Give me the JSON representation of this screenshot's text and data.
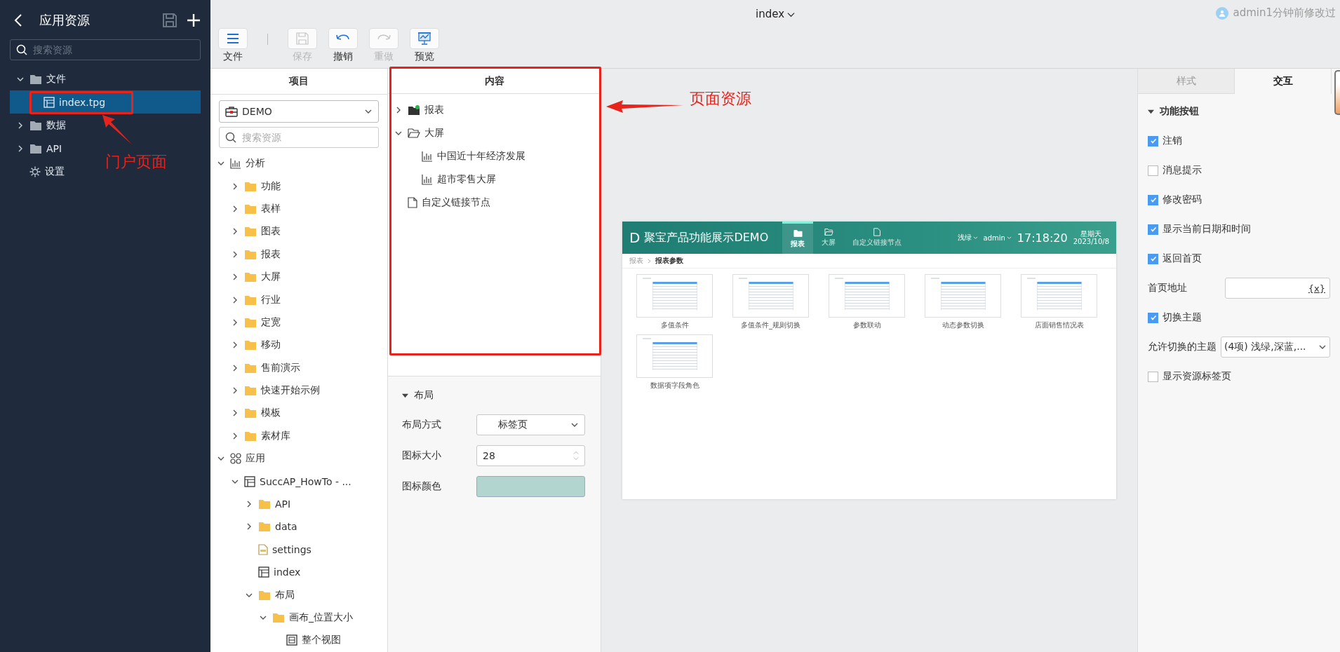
{
  "sidebar": {
    "title": "应用资源",
    "search": {
      "placeholder": "搜索资源"
    },
    "items": [
      {
        "label": "文件",
        "kind": "folder",
        "expanded": true,
        "selected": false,
        "children": [
          {
            "label": "index.tpg",
            "kind": "page",
            "selected": true
          }
        ]
      },
      {
        "label": "数据",
        "kind": "folder",
        "expanded": false,
        "selected": false
      },
      {
        "label": "API",
        "kind": "folder",
        "expanded": false,
        "selected": false
      },
      {
        "label": "设置",
        "kind": "settings",
        "selected": false
      }
    ]
  },
  "header": {
    "title": "index",
    "status": "admin1分钟前修改过"
  },
  "toolbar": [
    {
      "label": "文件",
      "kind": "menu",
      "disabled": false
    },
    {
      "label": "保存",
      "kind": "save",
      "disabled": true
    },
    {
      "label": "撤销",
      "kind": "undo",
      "disabled": false
    },
    {
      "label": "重做",
      "kind": "redo",
      "disabled": true
    },
    {
      "label": "预览",
      "kind": "preview",
      "disabled": false
    }
  ],
  "project": {
    "title": "项目",
    "name": "DEMO",
    "search": {
      "placeholder": "搜索资源"
    },
    "tree": [
      {
        "label": "分析",
        "kind": "chart",
        "expanded": true,
        "selected": false,
        "children": [
          {
            "label": "功能",
            "kind": "folder",
            "expanded": false,
            "selected": false
          },
          {
            "label": "表样",
            "kind": "folder",
            "expanded": false,
            "selected": false
          },
          {
            "label": "图表",
            "kind": "folder",
            "expanded": false,
            "selected": false
          },
          {
            "label": "报表",
            "kind": "folder",
            "expanded": false,
            "selected": false
          },
          {
            "label": "大屏",
            "kind": "folder",
            "expanded": false,
            "selected": false
          },
          {
            "label": "行业",
            "kind": "folder",
            "expanded": false,
            "selected": false
          },
          {
            "label": "定宽",
            "kind": "folder",
            "expanded": false,
            "selected": false
          },
          {
            "label": "移动",
            "kind": "folder",
            "expanded": false,
            "selected": false
          },
          {
            "label": "售前演示",
            "kind": "folder",
            "expanded": false,
            "selected": false
          },
          {
            "label": "快速开始示例",
            "kind": "folder",
            "expanded": false,
            "selected": false
          },
          {
            "label": "模板",
            "kind": "folder",
            "expanded": false,
            "selected": false
          },
          {
            "label": "素材库",
            "kind": "folder",
            "expanded": false,
            "selected": false
          }
        ]
      },
      {
        "label": "应用",
        "kind": "app",
        "expanded": true,
        "selected": false,
        "children": [
          {
            "label": "SuccAP_HowTo - ...",
            "kind": "page",
            "expanded": true,
            "selected": false,
            "children": [
              {
                "label": "API",
                "kind": "folder",
                "expanded": false,
                "selected": false
              },
              {
                "label": "data",
                "kind": "folder",
                "expanded": false,
                "selected": false
              },
              {
                "label": "settings",
                "kind": "json",
                "selected": false
              },
              {
                "label": "index",
                "kind": "page",
                "selected": false
              },
              {
                "label": "布局",
                "kind": "folder",
                "expanded": true,
                "selected": false,
                "children": [
                  {
                    "label": "画布_位置大小",
                    "kind": "folder",
                    "expanded": true,
                    "selected": false,
                    "children": [
                      {
                        "label": "整个视图",
                        "kind": "view",
                        "selected": false
                      }
                    ]
                  }
                ]
              }
            ]
          }
        ]
      }
    ]
  },
  "content": {
    "title": "内容",
    "tree": [
      {
        "label": "报表",
        "kind": "folder-dot",
        "expanded": false,
        "selected": false
      },
      {
        "label": "大屏",
        "kind": "folder-open",
        "expanded": true,
        "selected": false,
        "children": [
          {
            "label": "中国近十年经济发展",
            "kind": "chart",
            "selected": false
          },
          {
            "label": "超市零售大屏",
            "kind": "chart",
            "selected": false
          }
        ]
      },
      {
        "label": "自定义链接节点",
        "kind": "file",
        "selected": false
      }
    ],
    "layout": {
      "title": "布局",
      "expanded": true,
      "fields": [
        {
          "label": "布局方式",
          "kind": "select",
          "value": "标签页"
        },
        {
          "label": "图标大小",
          "kind": "number",
          "value": "28"
        },
        {
          "label": "图标颜色",
          "kind": "color",
          "color": "#b3d5cf"
        }
      ]
    }
  },
  "preview": {
    "logo": "D",
    "title": "聚宝产品功能展示DEMO",
    "nav": [
      {
        "label": "报表",
        "kind": "folder",
        "selected": true
      },
      {
        "label": "大屏",
        "kind": "folder-open",
        "selected": false
      },
      {
        "label": "自定义链接节点",
        "kind": "file",
        "selected": false
      }
    ],
    "theme": "浅绿",
    "user": "admin",
    "time": "17:18:20",
    "weekday": "星期天",
    "date": "2023/10/8",
    "breadcrumb": [
      "报表",
      "报表参数"
    ],
    "reports": [
      "多值条件",
      "多值条件_规则切换",
      "参数联动",
      "动态参数切换",
      "店面销售情况表",
      "数据项字段角色"
    ]
  },
  "properties": {
    "tabs": [
      {
        "label": "样式",
        "selected": false
      },
      {
        "label": "交互",
        "selected": true
      }
    ],
    "section": {
      "title": "功能按钮",
      "expanded": true
    },
    "rows": [
      {
        "kind": "checkbox",
        "label": "注销",
        "checked": true
      },
      {
        "kind": "checkbox",
        "label": "消息提示",
        "checked": false
      },
      {
        "kind": "checkbox",
        "label": "修改密码",
        "checked": true
      },
      {
        "kind": "checkbox",
        "label": "显示当前日期和时间",
        "checked": true
      },
      {
        "kind": "checkbox",
        "label": "返回首页",
        "checked": true
      },
      {
        "kind": "input",
        "label": "首页地址",
        "suffix": "{x}"
      },
      {
        "kind": "checkbox",
        "label": "切换主题",
        "checked": true
      },
      {
        "kind": "select",
        "label": "允许切换的主题",
        "value": "(4项) 浅绿,深蓝,..."
      },
      {
        "kind": "checkbox",
        "label": "显示资源标签页",
        "checked": false
      }
    ]
  },
  "annotations": [
    {
      "label": "门户页面"
    },
    {
      "label": "页面资源"
    }
  ]
}
